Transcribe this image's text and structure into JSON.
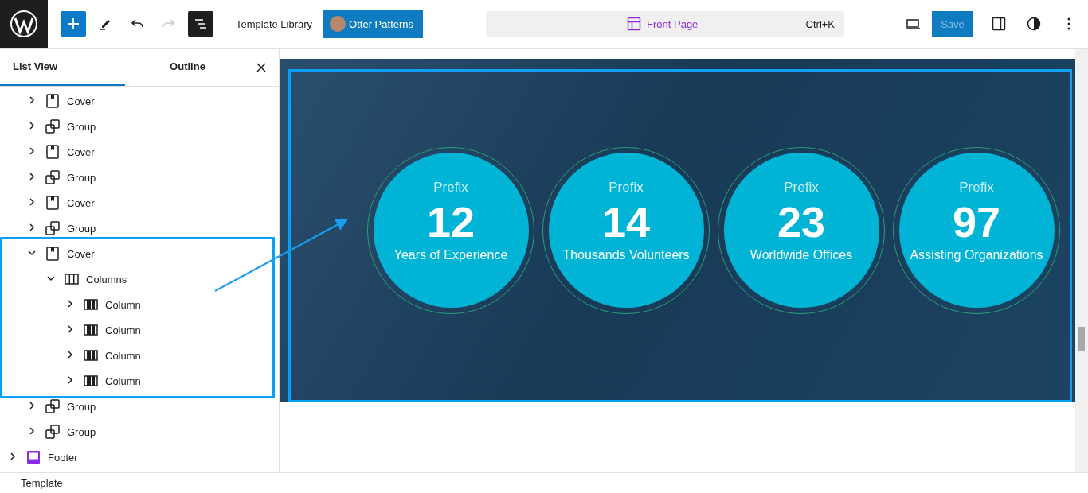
{
  "toolbar": {
    "template_library": "Template Library",
    "otter_patterns": "Otter Patterns",
    "redo_disabled": true,
    "list_view_pressed": true
  },
  "command_bar": {
    "title": "Front Page",
    "shortcut": "Ctrl+K"
  },
  "save": {
    "label": "Save",
    "disabled": true
  },
  "panel": {
    "tabs": [
      {
        "label": "List View",
        "selected": true
      },
      {
        "label": "Outline",
        "selected": false
      }
    ],
    "tree": [
      {
        "kind": "scrolled-parent",
        "children": [
          {
            "kind": "cover",
            "label": "Cover",
            "expanded": false
          },
          {
            "kind": "group",
            "label": "Group",
            "expanded": false
          },
          {
            "kind": "cover",
            "label": "Cover",
            "expanded": false
          },
          {
            "kind": "group",
            "label": "Group",
            "expanded": false
          },
          {
            "kind": "cover",
            "label": "Cover",
            "expanded": false
          },
          {
            "kind": "group",
            "label": "Group",
            "expanded": false
          },
          {
            "kind": "cover",
            "label": "Cover",
            "expanded": true,
            "children": [
              {
                "kind": "columns",
                "label": "Columns",
                "expanded": true,
                "children": [
                  {
                    "kind": "column",
                    "label": "Column",
                    "expanded": false
                  },
                  {
                    "kind": "column",
                    "label": "Column",
                    "expanded": false
                  },
                  {
                    "kind": "column",
                    "label": "Column",
                    "expanded": false
                  },
                  {
                    "kind": "column",
                    "label": "Column",
                    "expanded": false
                  }
                ]
              }
            ]
          },
          {
            "kind": "group",
            "label": "Group",
            "expanded": false
          },
          {
            "kind": "group",
            "label": "Group",
            "expanded": false
          }
        ]
      },
      {
        "kind": "footer",
        "label": "Footer",
        "expanded": false
      }
    ]
  },
  "stats": [
    {
      "prefix": "Prefix",
      "number": "12",
      "label": "Years of Experience"
    },
    {
      "prefix": "Prefix",
      "number": "14",
      "label": "Thousands Volunteers"
    },
    {
      "prefix": "Prefix",
      "number": "23",
      "label": "Worldwide Offices"
    },
    {
      "prefix": "Prefix",
      "number": "97",
      "label": "Assisting Organizations"
    }
  ],
  "status_bar": {
    "breadcrumb": "Template"
  }
}
